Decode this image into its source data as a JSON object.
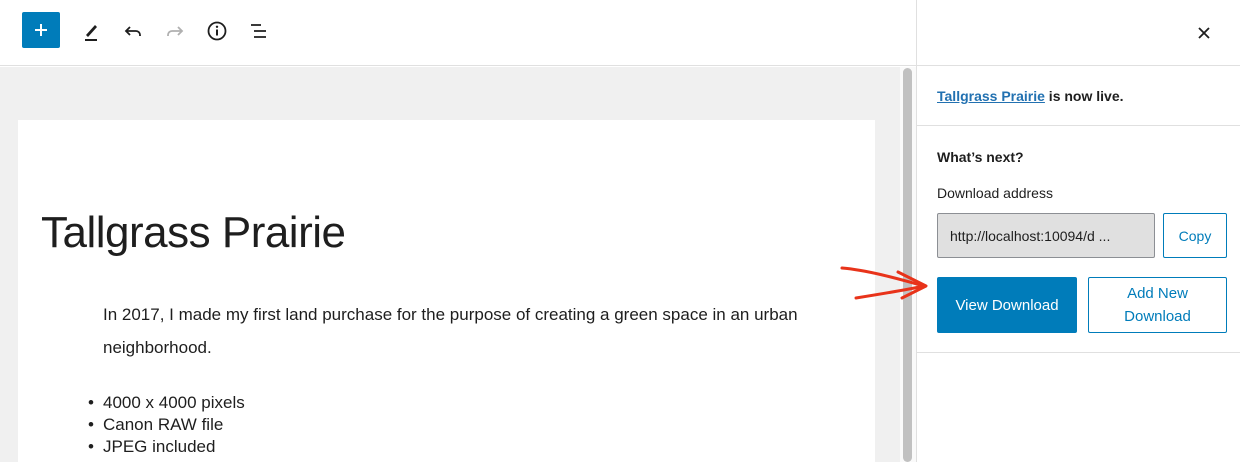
{
  "toolbar": {
    "add_block_icon": "plus-icon",
    "tool_icon": "pencil-icon",
    "undo_icon": "undo-icon",
    "redo_icon": "redo-icon",
    "info_icon": "info-icon",
    "outline_icon": "list-view-icon"
  },
  "post": {
    "title": "Tallgrass Prairie",
    "paragraph": "In 2017, I made my first land purchase for the purpose of creating a green space in an urban neighborhood.",
    "bullets": [
      "4000 x 4000 pixels",
      "Canon RAW file",
      "JPEG included"
    ]
  },
  "sidebar": {
    "close_icon": "close-icon",
    "live_link": "Tallgrass Prairie",
    "live_suffix": " is now live.",
    "next_heading": "What’s next?",
    "download_label": "Download address",
    "download_value": "http://localhost:10094/d ...",
    "copy_label": "Copy",
    "view_label": "View Download",
    "add_new_label": "Add New\nDownload"
  },
  "annotation": {
    "color": "#e8331a"
  },
  "colors": {
    "accent": "#007cba",
    "link": "#2271b1"
  }
}
